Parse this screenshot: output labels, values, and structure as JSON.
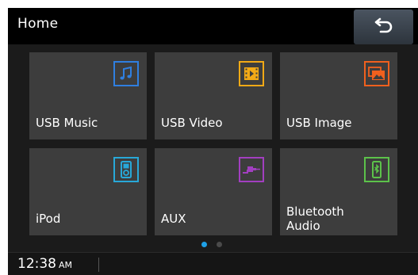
{
  "header": {
    "title": "Home",
    "back_icon": "back-arrow-icon"
  },
  "tiles": [
    {
      "label": "USB Music",
      "icon": "music-note-icon",
      "color": "#2f7fe0"
    },
    {
      "label": "USB Video",
      "icon": "film-play-icon",
      "color": "#f2a916"
    },
    {
      "label": "USB Image",
      "icon": "image-gallery-icon",
      "color": "#f0601e"
    },
    {
      "label": "iPod",
      "icon": "ipod-icon",
      "color": "#28a8d8"
    },
    {
      "label": "AUX",
      "icon": "aux-cable-icon",
      "color": "#a23fc0"
    },
    {
      "label": "Bluetooth Audio",
      "icon": "bluetooth-phone-icon",
      "color": "#5cc24a"
    }
  ],
  "pagination": {
    "active_color": "#1ea0e6",
    "inactive_color": "#4a4a4a"
  },
  "status": {
    "time": "12:38",
    "ampm": "AM"
  }
}
